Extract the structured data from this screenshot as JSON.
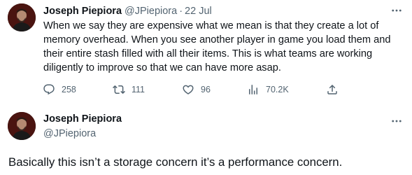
{
  "tweet": {
    "author_name": "Joseph Piepiora",
    "author_handle": "@JPiepiora",
    "separator": "·",
    "date": "22 Jul",
    "text": "When we say they are expensive what we mean is that they create a lot of memory overhead. When you see another player in game you load them and their entire stash filled with all their items. This is what teams are working diligently to improve so that we can have more asap.",
    "replies": "258",
    "retweets": "111",
    "likes": "96",
    "views": "70.2K"
  },
  "reply_tweet": {
    "author_name": "Joseph Piepiora",
    "author_handle": "@JPiepiora",
    "text": "Basically this isn’t a storage concern it’s a performance concern."
  },
  "icons": {
    "more": "more-horizontal-icon",
    "reply": "reply-bubble-icon",
    "retweet": "retweet-icon",
    "like": "heart-icon",
    "views": "bar-chart-icon",
    "share": "share-upload-icon"
  },
  "colors": {
    "text_primary": "#0f1419",
    "text_secondary": "#536471",
    "background": "#ffffff"
  }
}
